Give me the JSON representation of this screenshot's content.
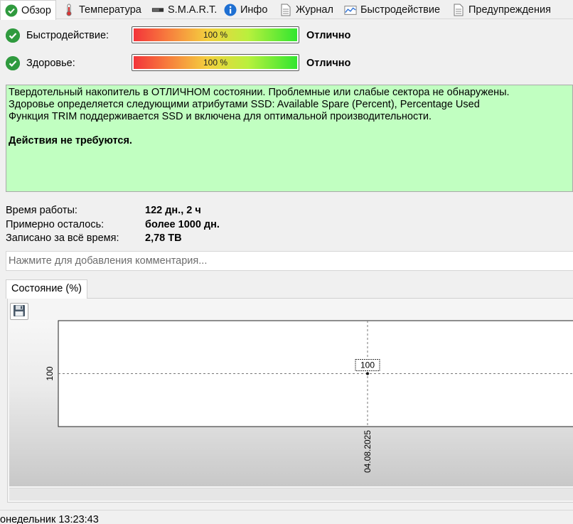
{
  "tabs": [
    {
      "label": "Обзор",
      "icon": "check-icon",
      "active": true
    },
    {
      "label": "Температура",
      "icon": "thermometer-icon",
      "active": false
    },
    {
      "label": "S.M.A.R.T.",
      "icon": "drive-icon",
      "active": false
    },
    {
      "label": "Инфо",
      "icon": "info-icon",
      "active": false
    },
    {
      "label": "Журнал",
      "icon": "document-icon",
      "active": false
    },
    {
      "label": "Быстродействие",
      "icon": "chart-icon",
      "active": false
    },
    {
      "label": "Предупреждения",
      "icon": "document-icon",
      "active": false
    }
  ],
  "overview": {
    "performance": {
      "label": "Быстродействие:",
      "percent_text": "100 %",
      "percent": 100,
      "status": "Отлично"
    },
    "health": {
      "label": "Здоровье:",
      "percent_text": "100 %",
      "percent": 100,
      "status": "Отлично"
    },
    "status_message": {
      "line1": "Твердотельный накопитель в ОТЛИЧНОМ состоянии. Проблемные или слабые сектора не обнаружены.",
      "line2": "Здоровье определяется следующими атрибутами SSD: Available Spare (Percent), Percentage Used",
      "line3": "Функция TRIM поддерживается SSD и включена для оптимальной производительности.",
      "action": "Действия не требуются.",
      "background_color": "#c1ffc1"
    },
    "info": {
      "uptime_label": "Время работы:",
      "uptime_value": "122 дн., 2 ч",
      "remaining_label": "Примерно осталось:",
      "remaining_value": "более 1000 дн.",
      "written_label": "Записано за всё время:",
      "written_value": "2,78 TB"
    },
    "comment_placeholder": "Нажмите для добавления комментария..."
  },
  "chart_tab": {
    "label": "Состояние (%)"
  },
  "chart_data": {
    "type": "line",
    "x": [
      "04.08.2025"
    ],
    "series": [
      {
        "values": [
          100
        ]
      }
    ],
    "ytick_labels": [
      "100"
    ],
    "xtick_labels": [
      "04.08.2025"
    ],
    "data_labels": [
      "100"
    ],
    "grid": true
  },
  "statusbar": {
    "text": "онедельник 13:23:43"
  },
  "colors": {
    "success": "#2f9a3e",
    "healthy_bg": "#c1ffc1"
  }
}
